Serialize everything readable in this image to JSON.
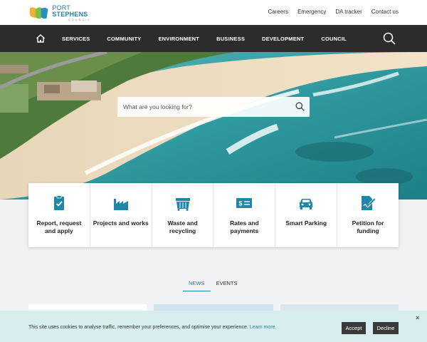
{
  "brand": {
    "name_light": "PORT ",
    "name_bold": "STEPHENS",
    "sub": "COUNCIL"
  },
  "utility_links": [
    "Careers",
    "Emergency",
    "DA tracker",
    "Contact us"
  ],
  "nav": {
    "items": [
      "SERVICES",
      "COMMUNITY",
      "ENVIRONMENT",
      "BUSINESS",
      "DEVELOPMENT",
      "COUNCIL"
    ]
  },
  "search": {
    "placeholder": "What are you looking for?"
  },
  "quick_links": [
    {
      "label": "Report, request and apply",
      "icon": "clipboard-check-icon"
    },
    {
      "label": "Projects and works",
      "icon": "factory-icon"
    },
    {
      "label": "Waste and recycling",
      "icon": "skip-bin-icon"
    },
    {
      "label": "Rates and payments",
      "icon": "dollar-bill-icon"
    },
    {
      "label": "Smart Parking",
      "icon": "car-icon"
    },
    {
      "label": "Petition for funding",
      "icon": "document-sign-icon"
    }
  ],
  "tabs": [
    {
      "label": "NEWS",
      "active": true
    },
    {
      "label": "EVENTS",
      "active": false
    }
  ],
  "cookie": {
    "text": "This site uses cookies to analyse traffic, remember your preferences, and optimise your experience. ",
    "link": "Learn more.",
    "accept": "Accept",
    "decline": "Decline",
    "close": "×"
  },
  "colors": {
    "accent": "#1e86a6",
    "nav_bg": "#2c2c2c",
    "cookie_bg": "#d8eeee"
  }
}
